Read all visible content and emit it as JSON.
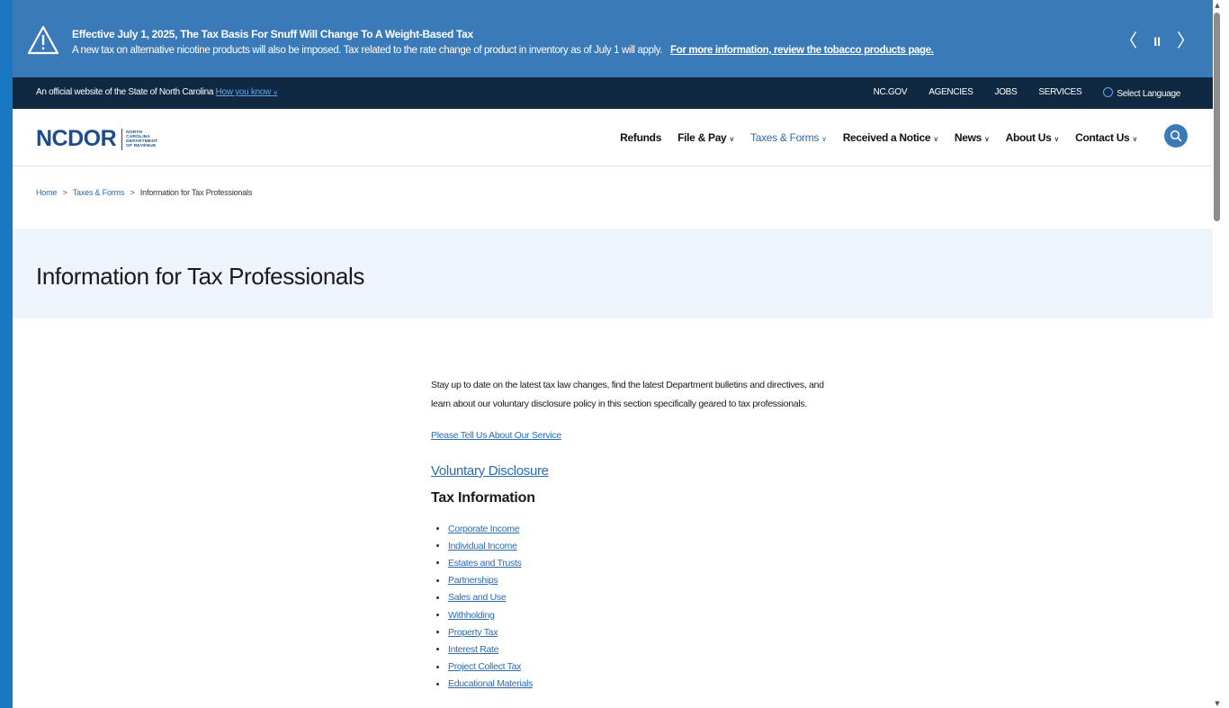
{
  "alert": {
    "title": "Effective July 1, 2025, The Tax Basis For Snuff Will Change To A Weight-Based Tax",
    "body": "A new tax on alternative nicotine products will also be imposed. Tax related to the rate change of product in inventory as of July 1 will apply.",
    "link": "For more information, review the tobacco products page.",
    "prev": "〈",
    "pause": "II",
    "next": "〉"
  },
  "official_bar": {
    "text": "An official website of the State of North Carolina",
    "how_link": "How you know",
    "links": [
      "NC.GOV",
      "AGENCIES",
      "JOBS",
      "SERVICES"
    ],
    "language": "Select Language"
  },
  "header": {
    "logo_text": "NCDOR",
    "logo_sub": [
      "NORTH",
      "CAROLINA",
      "DEPARTMENT",
      "OF REVENUE"
    ],
    "nav": [
      {
        "label": "Refunds",
        "has_menu": false
      },
      {
        "label": "File & Pay",
        "has_menu": true
      },
      {
        "label": "Taxes & Forms",
        "has_menu": true,
        "active": true
      },
      {
        "label": "Received a Notice",
        "has_menu": true
      },
      {
        "label": "News",
        "has_menu": true
      },
      {
        "label": "About Us",
        "has_menu": true
      },
      {
        "label": "Contact Us",
        "has_menu": true
      }
    ]
  },
  "breadcrumb": {
    "items": [
      "Home",
      "Taxes & Forms",
      "Information for Tax Professionals"
    ],
    "separator": ">"
  },
  "page_title": "Information for Tax Professionals",
  "main": {
    "intro_line1": "Stay up to date on the latest tax law changes, find the latest Department bulletins and directives, and",
    "intro_line2": "learn about our voluntary disclosure policy in this section specifically geared to tax professionals.",
    "survey_link": "Please Tell Us About Our Service",
    "voluntary_disclosure": "Voluntary Disclosure",
    "tax_info_heading": "Tax Information",
    "tax_links": [
      "Corporate Income",
      "Individual Income",
      "Estates and Trusts",
      "Partnerships",
      "Sales and Use",
      "Withholding",
      "Property Tax",
      "Interest Rate",
      "Project Collect Tax",
      "Educational Materials"
    ]
  },
  "colors": {
    "alert_bg": "#3b7ab8",
    "official_bg": "#0f2943",
    "link": "#2b6cb0",
    "hero_bg": "#eef4fb",
    "brand": "#1c4d8a"
  }
}
